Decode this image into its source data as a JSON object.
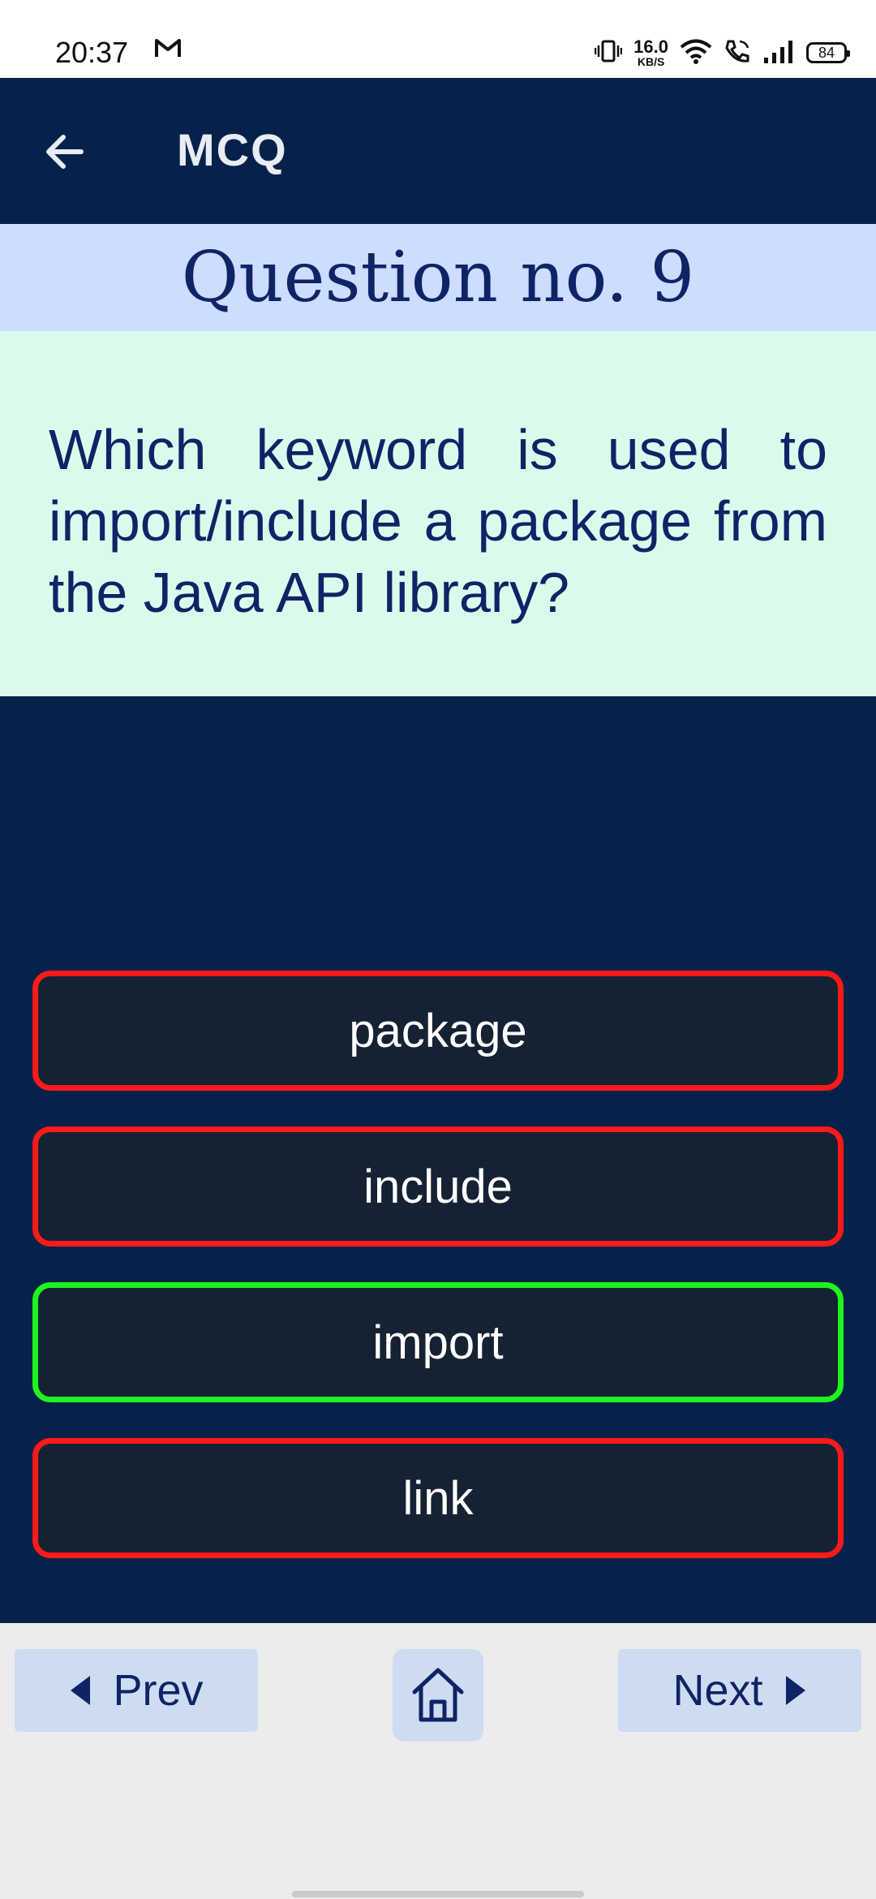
{
  "status_bar": {
    "time": "20:37",
    "net_speed_value": "16.0",
    "net_speed_unit": "KB/S",
    "battery_level": "84"
  },
  "app_bar": {
    "title": "MCQ"
  },
  "question": {
    "number_label": "Question no. 9",
    "text": "Which keyword is used to import/include a package from the Java API library?"
  },
  "options": [
    {
      "label": "package",
      "state": "wrong"
    },
    {
      "label": "include",
      "state": "wrong"
    },
    {
      "label": "import",
      "state": "correct"
    },
    {
      "label": "link",
      "state": "wrong"
    }
  ],
  "nav": {
    "prev_label": "Prev",
    "next_label": "Next"
  },
  "colors": {
    "primary_dark": "#07224a",
    "question_header_bg": "#cddcff",
    "question_box_bg": "#dbfaeb",
    "correct_border": "#1ef51e",
    "wrong_border": "#ff1a1a"
  }
}
